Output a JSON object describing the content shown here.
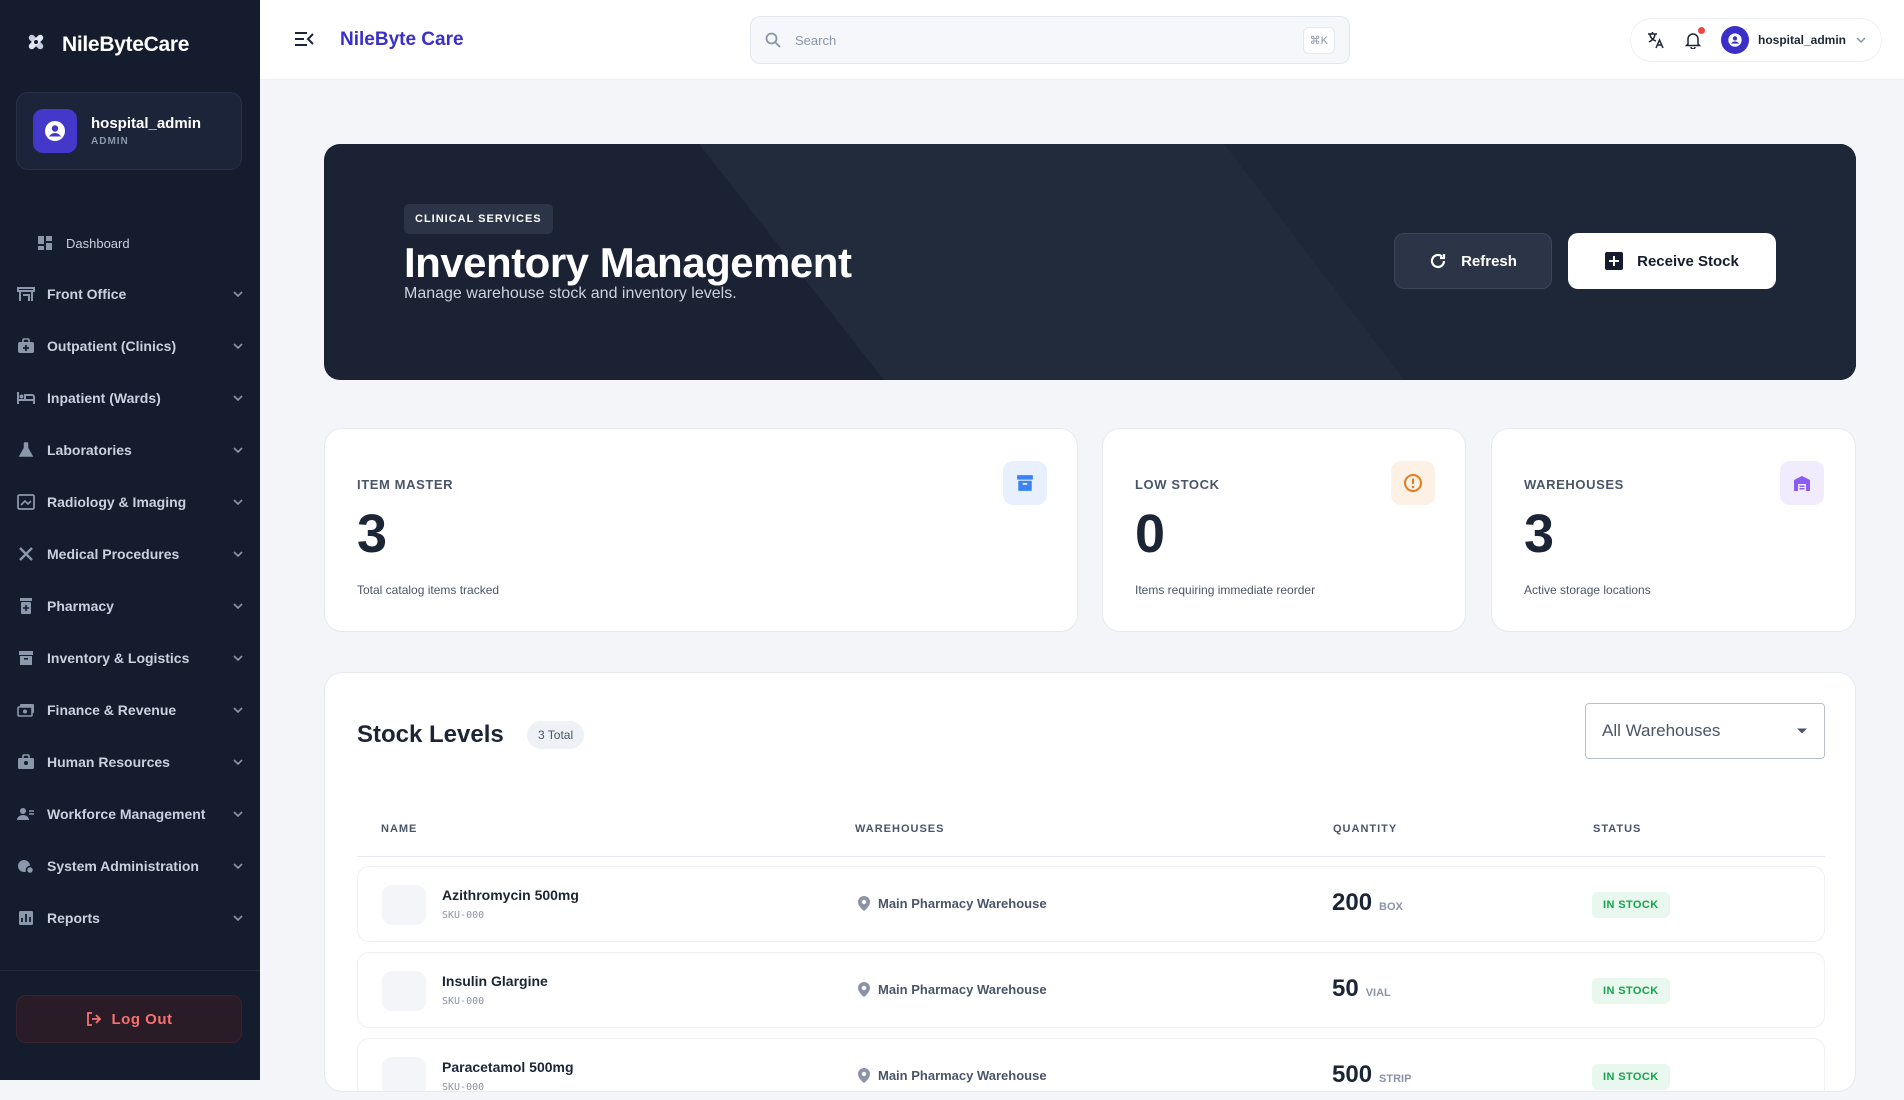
{
  "app": {
    "brand_name": "NileByteCare",
    "title": "NileByte Care"
  },
  "user": {
    "name": "hospital_admin",
    "role": "ADMIN"
  },
  "sidebar": {
    "dashboard": "Dashboard",
    "items": [
      {
        "label": "Front Office",
        "icon": "front-office-icon"
      },
      {
        "label": "Outpatient (Clinics)",
        "icon": "medical-bag-icon"
      },
      {
        "label": "Inpatient (Wards)",
        "icon": "bed-icon"
      },
      {
        "label": "Laboratories",
        "icon": "flask-icon"
      },
      {
        "label": "Radiology & Imaging",
        "icon": "scan-icon"
      },
      {
        "label": "Medical Procedures",
        "icon": "tools-icon"
      },
      {
        "label": "Pharmacy",
        "icon": "pill-bottle-icon"
      },
      {
        "label": "Inventory & Logistics",
        "icon": "archive-icon"
      },
      {
        "label": "Finance & Revenue",
        "icon": "money-icon"
      },
      {
        "label": "Human Resources",
        "icon": "badge-icon"
      },
      {
        "label": "Workforce Management",
        "icon": "people-icon"
      },
      {
        "label": "System Administration",
        "icon": "admin-icon"
      },
      {
        "label": "Reports",
        "icon": "chart-icon"
      }
    ],
    "logout": "Log Out"
  },
  "topbar": {
    "search_placeholder": "Search",
    "shortcut": "⌘K",
    "user_name": "hospital_admin"
  },
  "hero": {
    "tag": "CLINICAL SERVICES",
    "title": "Inventory Management",
    "subtitle": "Manage warehouse stock and inventory levels.",
    "refresh_label": "Refresh",
    "receive_label": "Receive Stock"
  },
  "stats": [
    {
      "label": "ITEM MASTER",
      "value": "3",
      "desc": "Total catalog items tracked",
      "color": "#3b82f6",
      "bg": "#e8f0fe"
    },
    {
      "label": "LOW STOCK",
      "value": "0",
      "desc": "Items requiring immediate reorder",
      "color": "#ea7a1a",
      "bg": "#fdf1e6"
    },
    {
      "label": "WAREHOUSES",
      "value": "3",
      "desc": "Active storage locations",
      "color": "#8b5cf6",
      "bg": "#f1ebfe"
    }
  ],
  "stock": {
    "title": "Stock Levels",
    "total_badge": "3 Total",
    "warehouse_filter": "All Warehouses",
    "columns": [
      "NAME",
      "WAREHOUSES",
      "QUANTITY",
      "STATUS"
    ],
    "rows": [
      {
        "name": "Azithromycin 500mg",
        "sku": "SKU-000",
        "warehouse": "Main Pharmacy Warehouse",
        "qty": "200",
        "unit": "BOX",
        "status": "IN STOCK"
      },
      {
        "name": "Insulin Glargine",
        "sku": "SKU-000",
        "warehouse": "Main Pharmacy Warehouse",
        "qty": "50",
        "unit": "VIAL",
        "status": "IN STOCK"
      },
      {
        "name": "Paracetamol 500mg",
        "sku": "SKU-000",
        "warehouse": "Main Pharmacy Warehouse",
        "qty": "500",
        "unit": "STRIP",
        "status": "IN STOCK"
      }
    ]
  },
  "colors": {
    "sidebar_bg": "#141c2e",
    "accent": "#3b2fc9",
    "hero_bg": "#1a2233",
    "in_stock": "#16a34a",
    "logout": "#f87171"
  }
}
